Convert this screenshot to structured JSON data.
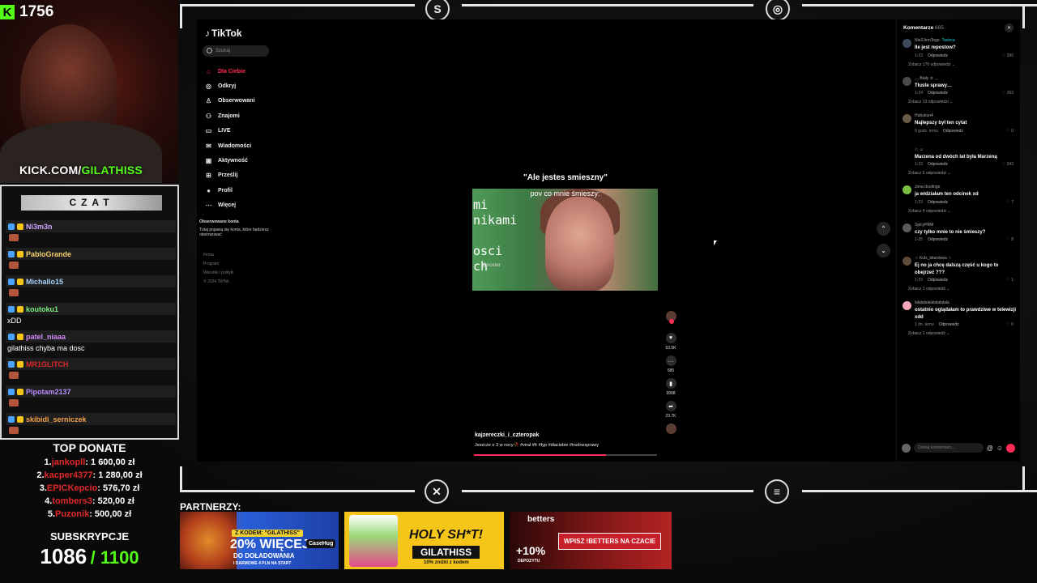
{
  "stream": {
    "kick_count": "1756",
    "kick_url_prefix": "KICK.COM/",
    "kick_url_user": "GILATHISS"
  },
  "chat": {
    "title": "CZAT",
    "messages": [
      {
        "user": "Ni3m3n",
        "color": "#c9a6ff",
        "text": ""
      },
      {
        "user": "PabloGrande",
        "color": "#f5d06b",
        "text": ""
      },
      {
        "user": "Michallo15",
        "color": "#a8d4ff",
        "text": ""
      },
      {
        "user": "koutoku1",
        "color": "#7cf07c",
        "text": "xDD"
      },
      {
        "user": "patel_niaaa",
        "color": "#d58cff",
        "text": "gilathiss chyba ma dosc"
      },
      {
        "user": "MR1GLITCH",
        "color": "#e0282a",
        "text": ""
      },
      {
        "user": "Pipotam2137",
        "color": "#b68cff",
        "text": ""
      },
      {
        "user": "skibidi_serniczek",
        "color": "#f5a04a",
        "text": ""
      }
    ]
  },
  "donates": {
    "title": "TOP DONATE",
    "rows": [
      {
        "rank": "1.",
        "name": "jankopll",
        "amount": ": 1 600,00 zł"
      },
      {
        "rank": "2.",
        "name": "kacper4377",
        "amount": ": 1 280,00 zł"
      },
      {
        "rank": "3.",
        "name": "EPICKepcio",
        "amount": ": 576,70 zł"
      },
      {
        "rank": "4.",
        "name": "tombers3",
        "amount": ": 520,00 zł"
      },
      {
        "rank": "5.",
        "name": "Puzonik",
        "amount": ": 500,00 zł"
      }
    ],
    "subs_title": "SUBSKRYPCJE",
    "subs_current": "1086",
    "subs_goal": "/ 1100"
  },
  "tiktok": {
    "logo": "TikTok",
    "search_placeholder": "Szukaj",
    "nav": [
      {
        "label": "Dla Ciebie",
        "icon": "home-icon",
        "glyph": "⌂",
        "active": true
      },
      {
        "label": "Odkryj",
        "icon": "compass-icon",
        "glyph": "◎",
        "active": false
      },
      {
        "label": "Obserwowani",
        "icon": "user-follow-icon",
        "glyph": "♙",
        "active": false
      },
      {
        "label": "Znajomi",
        "icon": "friends-icon",
        "glyph": "⚇",
        "active": false
      },
      {
        "label": "LIVE",
        "icon": "live-icon",
        "glyph": "▭",
        "active": false
      },
      {
        "label": "Wiadomości",
        "icon": "messages-icon",
        "glyph": "✉",
        "active": false
      },
      {
        "label": "Aktywność",
        "icon": "activity-icon",
        "glyph": "▣",
        "active": false
      },
      {
        "label": "Prześlij",
        "icon": "upload-icon",
        "glyph": "⊞",
        "active": false
      },
      {
        "label": "Profil",
        "icon": "profile-icon",
        "glyph": "●",
        "active": false
      },
      {
        "label": "Więcej",
        "icon": "more-icon",
        "glyph": "⋯",
        "active": false
      }
    ],
    "followed_title": "Obserwowane konta",
    "followed_text": "Tutaj pojawią się konta, które będziesz obserwować",
    "footer": [
      "Firma",
      "Program",
      "Warunki i polityki",
      "© 2024 TikTok"
    ],
    "video": {
      "caption_top": "\"Ale jestes smieszny\"",
      "overlay": "pov co mnie śmieszy:",
      "left_text": [
        "mi",
        "nikami",
        "",
        "osci",
        "ch"
      ],
      "watermark": "@noxter",
      "author": "kajzereczki_i_czteropak",
      "description": "Jeszcze o 3 w nocy🥀 #viral #fr #fyp #dlaciebie #trudnesprawy",
      "progress": 0.72
    },
    "actions": [
      {
        "icon": "heart-icon",
        "glyph": "♥",
        "count": "53.5K"
      },
      {
        "icon": "comment-icon",
        "glyph": "…",
        "count": "685"
      },
      {
        "icon": "bookmark-icon",
        "glyph": "▮",
        "count": "9998"
      },
      {
        "icon": "share-icon",
        "glyph": "➦",
        "count": "23.7K"
      }
    ]
  },
  "comments": {
    "title": "Komentarze",
    "count": "685",
    "items": [
      {
        "user": "Nie2JemTego",
        "creator": "· Twórca",
        "text": "Ile jest repostow?",
        "date": "1-23",
        "likes": "♡ 280",
        "more": "Zobacz 176 odpowiedzi ⌄",
        "av": "#3d4a5a"
      },
      {
        "user": "ˎ˗ˏ Biały ♔ ˎ˗ˏ",
        "creator": "",
        "text": "Tłuste sprawy…",
        "date": "1-24",
        "likes": "♡ 263",
        "more": "Zobacz 13 odpowiedzi ⌄",
        "av": "#4a4a4a"
      },
      {
        "user": "Hubukun4",
        "creator": "",
        "text": "Najlepszy był ten cytat",
        "date": "9 godz. temu",
        "likes": "♡ 0",
        "more": "",
        "av": "#6a5a4a"
      },
      {
        "user": "☆ ☺",
        "creator": "",
        "text": "Marzena od dwóch lat była Marzeną",
        "date": "1-23",
        "likes": "♡ 343",
        "more": "Zobacz 6 odpowiedzi ⌄",
        "av": "#000"
      },
      {
        "user": "Jona dooltngo",
        "creator": "",
        "text": "ja widziałam ten odcinek xd",
        "date": "1-23",
        "likes": "♡ 7",
        "more": "Zobacz 4 odpowiedzi ⌄",
        "av": "#7bc043"
      },
      {
        "user": "SpicyPRM",
        "creator": "",
        "text": "czy tylko mnie to nie śmieszy?",
        "date": "1-25",
        "likes": "♡ 8",
        "more": "",
        "av": "#5a5a5a"
      },
      {
        "user": "☆ Kuls_bilardowa ☆",
        "creator": "",
        "text": "Ej no ja chcę dalszą część u kogo to obejrzeć ???",
        "date": "1-23",
        "likes": "♡ 1",
        "more": "Zobacz 1 odpowiedź ⌄",
        "av": "#5c4a3a"
      },
      {
        "user": "lalalalalalalalalalala",
        "creator": "",
        "text": "ostatnio oglądałam to prawdziwe w telewizji xdd",
        "date": "1 dn. temu",
        "likes": "♡ 0",
        "more": "Zobacz 1 odpowiedź ⌄",
        "av": "#f4a7b9"
      }
    ],
    "reply_label": "Odpowiedz",
    "input_placeholder": "Dodaj komentarz..."
  },
  "partners": {
    "label": "PARTNERZY:",
    "ad1_code": "Z KODEM: \"GILATHISS\"",
    "ad1_main": "20% WIĘCEJ",
    "ad1_sub": "DO DOŁADOWANIA",
    "ad1_extra": "I DARMOWE 4 PLN NA START",
    "ad1_brand": "CaseHug",
    "ad2_main": "HOLY SH*T!",
    "ad2_code": "GILATHISS",
    "ad2_sub": "10% zniżki z kodem",
    "ad3_brand": "betters",
    "ad3_bonus": "+10%",
    "ad3_bonus_sub": "DEPOZYTU",
    "ad3_cta": "WPISZ !BETTERS NA CZACIE"
  }
}
